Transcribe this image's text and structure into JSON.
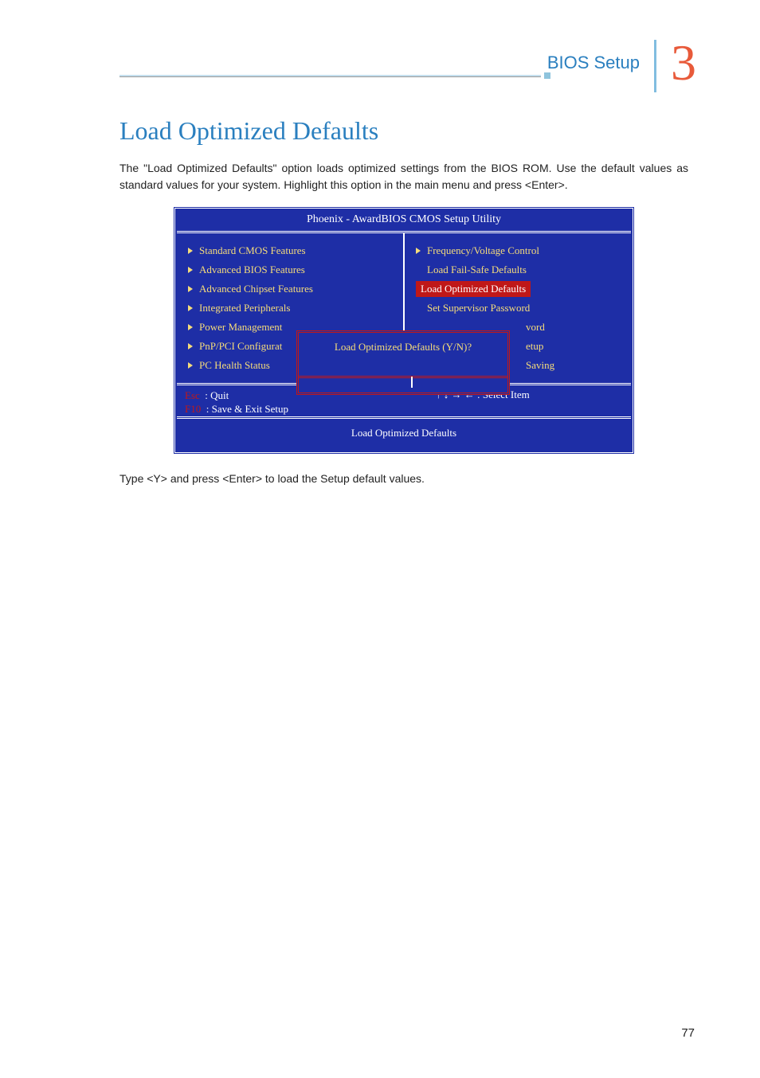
{
  "header": {
    "label": "BIOS Setup",
    "chapter_number": "3"
  },
  "section_title": "Load Optimized Defaults",
  "intro_paragraph": "The \"Load Optimized Defaults\" option loads optimized settings from the BIOS ROM. Use the default values as standard values for your system. Highlight this option in the main menu and press <Enter>.",
  "bios": {
    "title": "Phoenix - AwardBIOS CMOS Setup Utility",
    "left_items": [
      "Standard CMOS Features",
      "Advanced BIOS Features",
      "Advanced Chipset Features",
      "Integrated Peripherals",
      "Power Management",
      "PnP/PCI Configurat",
      "PC Health Status"
    ],
    "right_items": [
      {
        "label": "Frequency/Voltage Control",
        "has_tri": true,
        "selected": false
      },
      {
        "label": "Load Fail-Safe Defaults",
        "has_tri": false,
        "selected": false
      },
      {
        "label": "Load Optimized Defaults",
        "has_tri": false,
        "selected": true
      },
      {
        "label": "Set Supervisor Password",
        "has_tri": false,
        "selected": false
      }
    ],
    "right_fragments": [
      "vord",
      "etup",
      "Saving"
    ],
    "popup_text": "Load Optimized Defaults (Y/N)?",
    "help": {
      "esc_key": "Esc",
      "esc_label": ":   Quit",
      "f10_key": "F10",
      "f10_label": ":   Save & Exit Setup",
      "select_hint": "↑ ↓ → ← : Select Item"
    },
    "footer": "Load Optimized Defaults"
  },
  "closing_paragraph": "Type <Y> and press <Enter> to load the Setup default values.",
  "page_number": "77"
}
